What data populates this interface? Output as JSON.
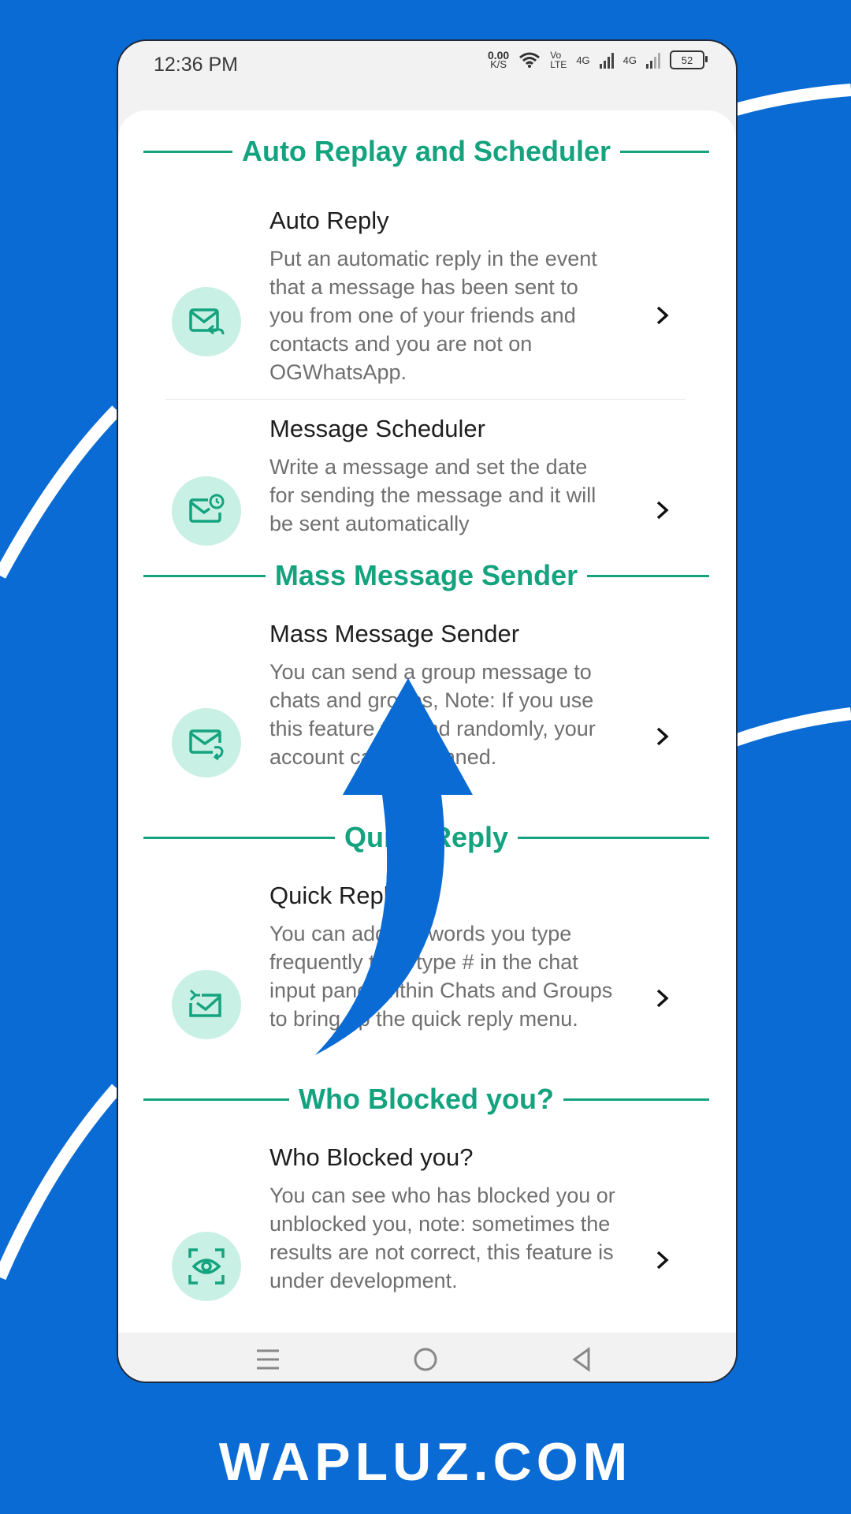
{
  "status": {
    "time": "12:36 PM",
    "net_speed_value": "0.00",
    "net_speed_unit": "K/S",
    "volte_top": "Vo",
    "volte_bottom": "LTE",
    "sim1": "4G",
    "sim2": "4G",
    "battery": "52"
  },
  "sections": [
    {
      "header": "Auto Replay and Scheduler",
      "items": [
        {
          "title": "Auto Reply",
          "desc": "Put an automatic reply in the event that a message has been sent to you from one of your friends and contacts and you are not on OGWhatsApp.",
          "icon": "mail-reply-icon"
        },
        {
          "title": "Message Scheduler",
          "desc": "Write a message and set the date for sending the message and it will be sent automatically",
          "icon": "mail-clock-icon"
        }
      ]
    },
    {
      "header": "Mass Message Sender",
      "items": [
        {
          "title": "Mass Message Sender",
          "desc": "You can send a group message to chats and groups, Note: If you use this feature to send randomly, your account can be banned.",
          "icon": "mail-forward-icon"
        }
      ]
    },
    {
      "header": "Quick Reply",
      "items": [
        {
          "title": "Quick Reply",
          "desc": "You can add the words you type frequently then type # in the chat input panel within Chats and Groups to bring up the quick reply menu.",
          "icon": "mail-quick-icon"
        }
      ]
    },
    {
      "header": "Who Blocked you?",
      "items": [
        {
          "title": "Who Blocked you?",
          "desc": "You can see who has blocked you or unblocked you, note: sometimes the results are not correct, this feature is under development.",
          "icon": "eye-scan-icon"
        }
      ]
    }
  ],
  "nav": {
    "menu_icon": "menu-icon",
    "home_icon": "home-circle-icon",
    "back_icon": "back-triangle-icon"
  },
  "colors": {
    "accent": "#14a37f",
    "icon_bg": "#c9f0e4",
    "background": "#0a6bd4"
  },
  "brand": "WAPLUZ.COM"
}
